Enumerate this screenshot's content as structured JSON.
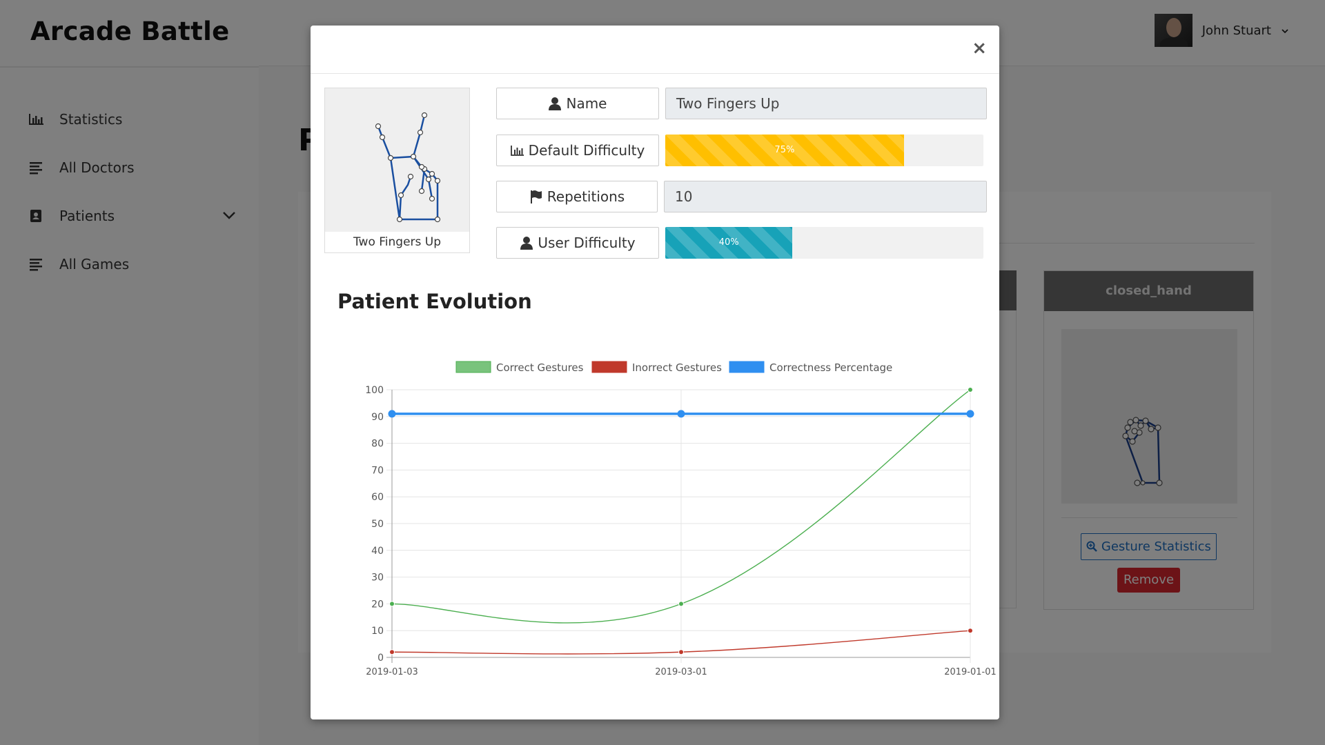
{
  "app": {
    "brand": "Arcade Battle"
  },
  "sidebar": {
    "items": [
      {
        "label": "Statistics",
        "icon": "bar-chart-icon"
      },
      {
        "label": "All Doctors",
        "icon": "list-icon"
      },
      {
        "label": "Patients",
        "icon": "address-book-icon",
        "chevron": "chevron-down-icon"
      },
      {
        "label": "All Games",
        "icon": "list-icon"
      }
    ]
  },
  "header": {
    "user_name": "John Stuart",
    "user_chevron": "⌄"
  },
  "page": {
    "title_fragment": "P"
  },
  "background_card": {
    "title": "closed_hand",
    "stats_button": "Gesture Statistics",
    "remove_button": "Remove"
  },
  "modal": {
    "close_label": "×",
    "gesture_caption": "Two Fingers Up",
    "fields": {
      "name_label": "Name",
      "name_value": "Two Fingers Up",
      "default_difficulty_label": "Default Difficulty",
      "default_difficulty_value": 75,
      "default_difficulty_text": "75%",
      "repetitions_label": "Repetitions",
      "repetitions_value": "10",
      "user_difficulty_label": "User Difficulty",
      "user_difficulty_value": 40,
      "user_difficulty_text": "40%"
    },
    "section_title": "Patient Evolution"
  },
  "colors": {
    "correct": "#4caf50",
    "incorrect": "#c0392b",
    "percentage": "#2f8ff0",
    "warning": "#ffbf00",
    "info": "#17a2b8"
  },
  "chart_data": {
    "type": "line",
    "title": "",
    "xlabel": "",
    "ylabel": "",
    "categories": [
      "2019-01-03",
      "2019-03-01",
      "2019-01-01"
    ],
    "ylim": [
      0,
      100
    ],
    "yticks": [
      0,
      10,
      20,
      30,
      40,
      50,
      60,
      70,
      80,
      90,
      100
    ],
    "grid": true,
    "legend_position": "top",
    "series": [
      {
        "name": "Correct Gestures",
        "values": [
          20,
          20,
          100
        ],
        "color": "#4caf50"
      },
      {
        "name": "Inorrect Gestures",
        "values": [
          2,
          2,
          10
        ],
        "color": "#c0392b"
      },
      {
        "name": "Correctness Percentage",
        "values": [
          91,
          91,
          91
        ],
        "color": "#2f8ff0"
      }
    ]
  }
}
